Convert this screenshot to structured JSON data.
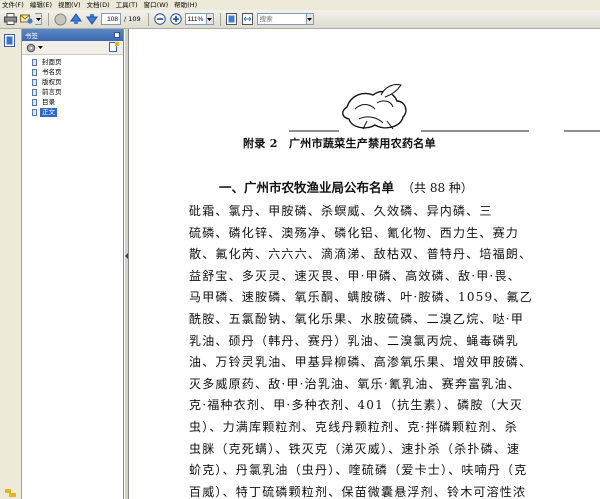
{
  "menu": [
    "文件(F)",
    "编辑(E)",
    "视图(V)",
    "文档(D)",
    "工具(T)",
    "窗口(W)",
    "帮助(H)"
  ],
  "toolbar": {
    "current_page": "108",
    "total_pages": "/ 109",
    "zoom": "111%",
    "search_placeholder": "搜索"
  },
  "bookmarks_panel": {
    "title": "书签",
    "items": [
      {
        "label": "封面页",
        "selected": false
      },
      {
        "label": "书名页",
        "selected": false
      },
      {
        "label": "版权页",
        "selected": false
      },
      {
        "label": "前言页",
        "selected": false
      },
      {
        "label": "目录",
        "selected": false
      },
      {
        "label": "正文",
        "selected": true
      }
    ]
  },
  "page": {
    "appendix_title": "附录 2　广州市蔬菜生产禁用农药名单",
    "section_heading": "一、广州市农牧渔业局公布名单",
    "section_count": "（共 88 种）",
    "body_lines": [
      "砒霜、氯丹、甲胺磷、杀螟威、久效磷、异内磷、三",
      "硫磷、磷化锌、澳殇净、磷化铝、氰化物、西力生、赛力",
      "散、氟化芮、六六六、滴滴涕、敌枯双、普特丹、培福朗、",
      "益舒宝、多灭灵、速灭畏、甲·甲磷、高效磷、敌·甲·畏、",
      "马甲磷、速胺磷、氧乐酮、螨胺磷、叶·胺磷、1059、氟乙",
      "酰胺、五氯酚钠、氧化乐果、水胺硫磷、二溴乙烷、哒·甲",
      "乳油、硕丹（韩丹、赛丹）乳油、二溴氯丙烷、蝇毒磷乳",
      "油、万铃灵乳油、甲基异柳磷、高渗氧乐果、增效甲胺磷、",
      "灭多威原药、敌·甲·治乳油、氧乐·氰乳油、赛奔富乳油、",
      "克·福种衣剂、甲·多种衣剂、401（抗生素）、磷胺（大灭",
      "虫）、力满库颗粒剂、克线丹颗粒剂、克·拌磷颗粒剂、杀",
      "虫脒（克死螨）、铁灭克（涕灭威）、速扑杀（杀扑磷、速",
      "蚧克）、丹氯乳油（虫丹）、喹硫磷（爱卡士）、呋喃丹（克",
      "百威）、特丁硫磷颗粒剂、保苗微囊悬浮剂、铃木可溶性浓"
    ]
  }
}
